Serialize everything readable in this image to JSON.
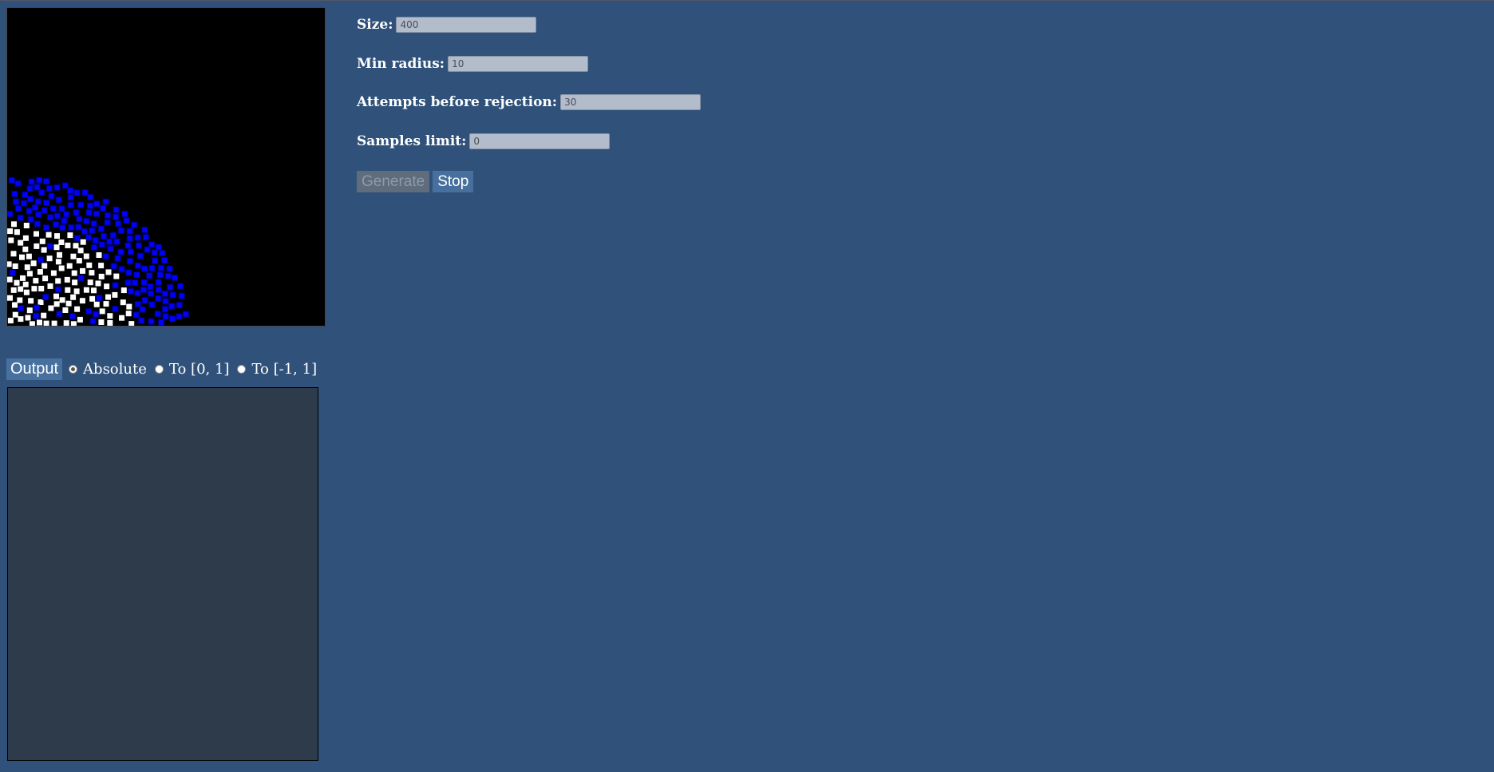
{
  "controls": {
    "size_label": "Size:",
    "size_value": "400",
    "min_radius_label": "Min radius:",
    "min_radius_value": "10",
    "attempts_label": "Attempts before rejection:",
    "attempts_value": "30",
    "samples_label": "Samples limit:",
    "samples_value": "0"
  },
  "buttons": {
    "generate_label": "Generate",
    "generate_disabled": true,
    "stop_label": "Stop"
  },
  "output": {
    "button_label": "Output",
    "options": [
      "Absolute",
      "To [0, 1]",
      "To [-1, 1]"
    ],
    "selected": "Absolute",
    "content": ""
  },
  "canvas": {
    "background": "#000000",
    "active_color": "#0000ff",
    "active_border": "#000080",
    "sample_color": "#ffffff"
  },
  "colors": {
    "page_bg": "#30527a",
    "button_bg": "#47709f",
    "input_bg": "#b2bccb",
    "output_bg": "#2e3b4b"
  }
}
